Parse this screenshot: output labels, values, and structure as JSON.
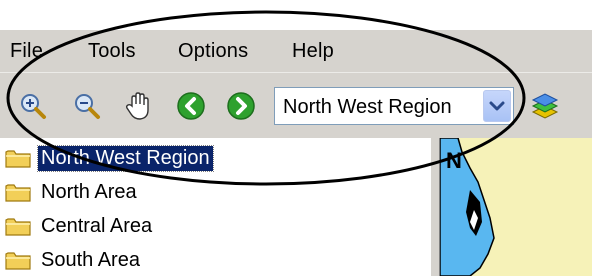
{
  "menu": {
    "items": [
      {
        "label": "File"
      },
      {
        "label": "Tools"
      },
      {
        "label": "Options"
      },
      {
        "label": "Help"
      }
    ]
  },
  "toolbar": {
    "buttons": [
      {
        "icon": "zoom-in-icon"
      },
      {
        "icon": "zoom-out-icon"
      },
      {
        "icon": "pan-hand-icon"
      },
      {
        "icon": "back-arrow-icon"
      },
      {
        "icon": "forward-arrow-icon"
      },
      {
        "icon": "layers-icon"
      }
    ],
    "region_select": {
      "value": "North West Region"
    }
  },
  "tree": {
    "items": [
      {
        "label": "North West Region",
        "selected": true
      },
      {
        "label": "North Area",
        "selected": false
      },
      {
        "label": "Central Area",
        "selected": false
      },
      {
        "label": "South Area",
        "selected": false
      }
    ]
  },
  "map": {
    "label": "N",
    "water_color": "#59b7f0",
    "land_color": "#f6f2b8"
  },
  "colors": {
    "chrome": "#d6d3ce",
    "selection": "#0a246a",
    "nav_green": "#2ea12e"
  }
}
